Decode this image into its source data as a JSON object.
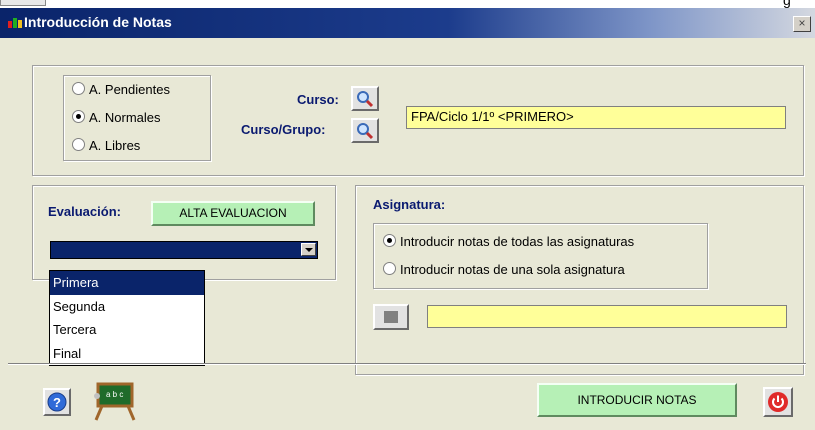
{
  "window": {
    "title": "Introducción de Notas",
    "close_glyph": "×",
    "background_fragment": "g"
  },
  "origin_group": {
    "options": [
      {
        "label": "A. Pendientes",
        "checked": false
      },
      {
        "label": "A. Normales",
        "checked": true
      },
      {
        "label": "A. Libres",
        "checked": false
      }
    ]
  },
  "course": {
    "curso_label": "Curso:",
    "curso_grupo_label": "Curso/Grupo:",
    "value": "FPA/Ciclo 1/1º <PRIMERO>",
    "search_icon": "magnifier-icon"
  },
  "evaluation": {
    "label": "Evaluación:",
    "alta_button": "ALTA EVALUACION",
    "selected_value": "",
    "options": [
      "Primera",
      "Segunda",
      "Tercera",
      "Final"
    ],
    "highlighted_index": 0
  },
  "subject": {
    "label": "Asignatura:",
    "options": [
      {
        "label": "Introducir notas de todas las asignaturas",
        "checked": true
      },
      {
        "label": "Introducir notas de una sola asignatura",
        "checked": false
      }
    ],
    "value": ""
  },
  "footer": {
    "introducir_button": "INTRODUCIR NOTAS",
    "help_icon": "help-icon",
    "classroom_icon": "blackboard-icon",
    "power_icon": "power-icon"
  },
  "colors": {
    "title_bar": "#0a246a",
    "panel_background": "#e8e8d6",
    "field_yellow": "#ffff99",
    "label_blue": "#0a1a70",
    "button_green": "#b6f0b6"
  }
}
